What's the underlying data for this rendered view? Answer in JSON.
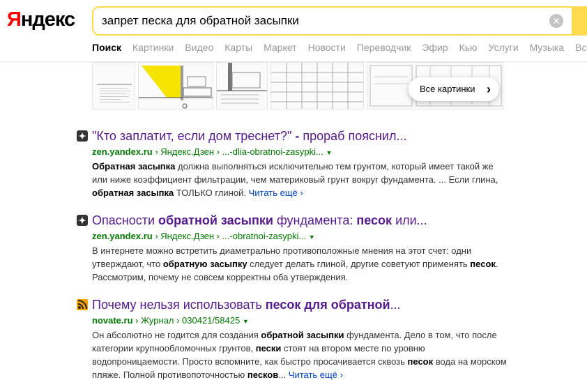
{
  "logo": {
    "first_letter": "Я",
    "rest": "ндекс"
  },
  "search": {
    "query": "запрет песка для обратной засыпки",
    "clear_symbol": "✕"
  },
  "tabs": [
    "Поиск",
    "Картинки",
    "Видео",
    "Карты",
    "Маркет",
    "Новости",
    "Переводчик",
    "Эфир",
    "Кью",
    "Услуги",
    "Музыка",
    "Вс"
  ],
  "images": {
    "all_images_label": "Все картинки"
  },
  "results": [
    {
      "title_parts": [
        {
          "text": "\"Кто заплатит, если дом треснет?\" ",
          "bold": false
        },
        {
          "text": "-",
          "bold": true
        },
        {
          "text": " прораб пояснил...",
          "bold": false
        }
      ],
      "domain": "zen.yandex.ru",
      "breadcrumb": " › Яндекс.Дзен › ...-dlia-obratnoi-zasypki...",
      "snippet_parts": [
        {
          "text": "Обратная засыпка",
          "bold": true
        },
        {
          "text": " должна выполняться исключительно тем грунтом, который имеет такой же или ниже коэффициент фильтрации, чем материковый грунт вокруг фундамента. ... Если глина, ",
          "bold": false
        },
        {
          "text": "обратная засыпка",
          "bold": true
        },
        {
          "text": " ТОЛЬКО глиной. ",
          "bold": false
        }
      ],
      "read_more": "Читать ещё ›"
    },
    {
      "title_parts": [
        {
          "text": "Опасности ",
          "bold": false
        },
        {
          "text": "обратной засыпки",
          "bold": true
        },
        {
          "text": " фундамента: ",
          "bold": false
        },
        {
          "text": "песок",
          "bold": true
        },
        {
          "text": " или...",
          "bold": false
        }
      ],
      "domain": "zen.yandex.ru",
      "breadcrumb": " › Яндекс.Дзен › ...-obratnoi-zasypki...",
      "snippet_parts": [
        {
          "text": "В интернете можно встретить диаметрально противоположные мнения на этот счет: одни утверждают, что ",
          "bold": false
        },
        {
          "text": "обратную засыпку",
          "bold": true
        },
        {
          "text": " следует делать глиной, другие советуют применять ",
          "bold": false
        },
        {
          "text": "песок",
          "bold": true
        },
        {
          "text": ". Рассмотрим, почему не совсем корректны оба утверждения.",
          "bold": false
        }
      ],
      "read_more": ""
    },
    {
      "title_parts": [
        {
          "text": "Почему нельзя использовать ",
          "bold": false
        },
        {
          "text": "песок для обратной",
          "bold": true
        },
        {
          "text": "...",
          "bold": false
        }
      ],
      "domain": "novate.ru",
      "breadcrumb": " › Журнал › 030421/58425",
      "snippet_parts": [
        {
          "text": "Он абсолютно не годится для создания ",
          "bold": false
        },
        {
          "text": "обратной засыпки",
          "bold": true
        },
        {
          "text": " фундамента. Дело в том, что после категории крупнообломочных грунтов, ",
          "bold": false
        },
        {
          "text": "пески",
          "bold": true
        },
        {
          "text": " стоят на втором месте по уровню водопроницаемости. Просто вспомните, как быстро просачивается сквозь ",
          "bold": false
        },
        {
          "text": "песок",
          "bold": true
        },
        {
          "text": " вода на морском пляже. Полной противопоточностью ",
          "bold": false
        },
        {
          "text": "песков",
          "bold": true
        },
        {
          "text": "... ",
          "bold": false
        }
      ],
      "read_more": "Читать ещё ›"
    }
  ],
  "colors": {
    "accent": "#ffdb4d",
    "title": "#551a8b",
    "url": "#007700",
    "link": "#0044bb",
    "logo_red": "#ff0000"
  }
}
